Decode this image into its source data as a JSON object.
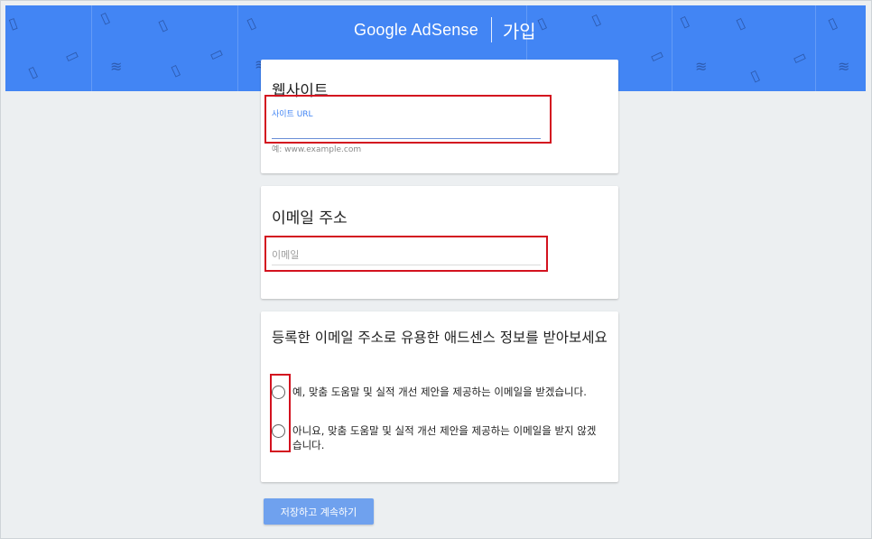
{
  "header": {
    "logo_text": "Google AdSense",
    "signup_label": "가입",
    "background_color": "#4285f4",
    "decor_icons": [
      "phone-icon",
      "money-icon",
      "layers-icon"
    ]
  },
  "website_section": {
    "title": "웹사이트",
    "url_label": "사이트 URL",
    "url_value": "",
    "hint": "예: www.example.com"
  },
  "email_section": {
    "title": "이메일 주소",
    "placeholder": "이메일",
    "value": ""
  },
  "updates_section": {
    "title": "등록한 이메일 주소로 유용한 애드센스 정보를 받아보세요",
    "options": [
      {
        "label": "예, 맞춤 도움말 및 실적 개선 제안을 제공하는 이메일을 받겠습니다.",
        "selected": false
      },
      {
        "label": "아니요, 맞춤 도움말 및 실적 개선 제안을 제공하는 이메일을 받지 않겠습니다.",
        "selected": false
      }
    ]
  },
  "actions": {
    "save_label": "저장하고 계속하기"
  },
  "colors": {
    "highlight_box": "#d3121f",
    "primary_button": "#6fa1ee",
    "label_accent": "#4285f4"
  }
}
